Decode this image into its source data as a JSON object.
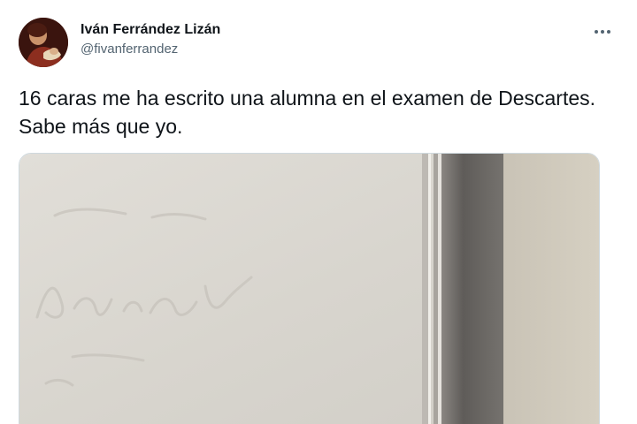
{
  "tweet": {
    "author": {
      "display_name": "Iván Ferrández Lizán",
      "handle": "@fivanferrandez"
    },
    "text": "16 caras me ha escrito una alumna en el examen de Descartes. Sabe más que yo.",
    "more_icon": "more-horizontal-icon",
    "media": {
      "description_icon": "photo"
    }
  },
  "colors": {
    "text_primary": "#0f1419",
    "text_secondary": "#536471",
    "paper": "#dcd9d3",
    "border": "#cfd9de"
  }
}
